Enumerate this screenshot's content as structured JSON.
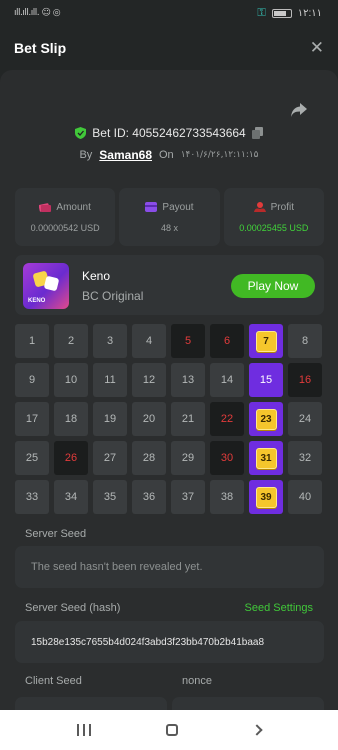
{
  "status_bar": {
    "time": "۱۲:۱۱",
    "left_icons": "ıll.ıll.ıll.  ☺ ◎"
  },
  "header": {
    "title": "Bet Slip",
    "close_icon": "close-icon"
  },
  "bet": {
    "id_label": "Bet ID: 40552462733543664",
    "by_label": "By",
    "username": "Saman68",
    "on_label": "On",
    "date": "۱۴۰۱/۶/۲۶,۱۲:۱۱:۱۵"
  },
  "stats": {
    "amount": {
      "label": "Amount",
      "value": "0.00000542 USD",
      "color": "#e0457a"
    },
    "payout": {
      "label": "Payout",
      "value": "48 x",
      "color": "#8a4de8"
    },
    "profit": {
      "label": "Profit",
      "value": "0.00025455 USD",
      "color": "#e23b3b"
    }
  },
  "game": {
    "name": "Keno",
    "subtitle": "BC Original",
    "thumb_label": "KENO",
    "play_label": "Play Now"
  },
  "keno_grid": {
    "numbers": [
      1,
      2,
      3,
      4,
      5,
      6,
      7,
      8,
      9,
      10,
      11,
      12,
      13,
      14,
      15,
      16,
      17,
      18,
      19,
      20,
      21,
      22,
      23,
      24,
      25,
      26,
      27,
      28,
      29,
      30,
      31,
      32,
      33,
      34,
      35,
      36,
      37,
      38,
      39,
      40
    ],
    "misses": [
      5,
      6,
      16,
      22,
      26,
      30
    ],
    "selected": [
      15
    ],
    "hits": [
      7,
      23,
      31,
      39
    ]
  },
  "seeds": {
    "server_seed_label": "Server Seed",
    "server_seed_value": "The seed hasn't been revealed yet.",
    "server_hash_label": "Server Seed (hash)",
    "seed_settings_label": "Seed Settings",
    "server_hash_value": "15b28e135c7655b4d024f3abd3f23bb470b2b41baa8",
    "client_seed_label": "Client Seed",
    "nonce_label": "nonce"
  },
  "colors": {
    "accent_green": "#41b924",
    "purple": "#6f2de0",
    "gold": "#f5c62c"
  }
}
